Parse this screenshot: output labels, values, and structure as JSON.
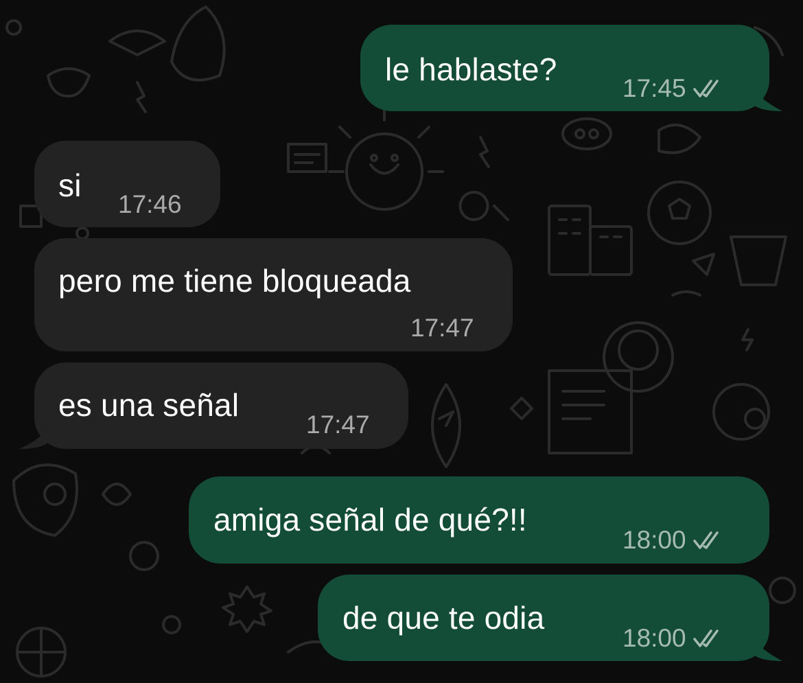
{
  "colors": {
    "outgoing_bubble": "#144d37",
    "incoming_bubble": "#232323",
    "background": "#0c0c0c",
    "doodle": "#2a2a2a"
  },
  "messages": [
    {
      "direction": "outgoing",
      "text": "le hablaste?",
      "time": "17:45",
      "status_icon": "double-check-icon"
    },
    {
      "direction": "incoming",
      "text": "si",
      "time": "17:46"
    },
    {
      "direction": "incoming",
      "text": "pero me tiene bloqueada",
      "time": "17:47"
    },
    {
      "direction": "incoming",
      "text": "es una señal",
      "time": "17:47"
    },
    {
      "direction": "outgoing",
      "text": "amiga señal de qué?!!",
      "time": "18:00",
      "status_icon": "double-check-icon"
    },
    {
      "direction": "outgoing",
      "text": "de que te odia",
      "time": "18:00",
      "status_icon": "double-check-icon"
    }
  ]
}
